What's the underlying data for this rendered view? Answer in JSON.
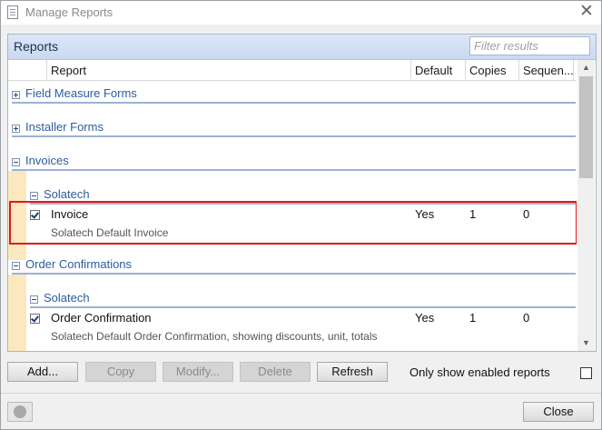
{
  "window": {
    "title": "Manage Reports",
    "close_glyph": "✕"
  },
  "panel": {
    "title": "Reports",
    "filter_placeholder": "Filter results"
  },
  "columns": {
    "report": "Report",
    "default": "Default",
    "copies": "Copies",
    "sequence": "Sequen..."
  },
  "groups": {
    "field_measure": "Field Measure Forms",
    "installer": "Installer Forms",
    "invoices": "Invoices",
    "invoices_vendor": "Solatech",
    "order_confirmations": "Order Confirmations",
    "order_vendor": "Solatech"
  },
  "items": {
    "invoice": {
      "name": "Invoice",
      "description": "Solatech Default Invoice",
      "default": "Yes",
      "copies": "1",
      "sequence": "0",
      "checked": true
    },
    "order_confirmation": {
      "name": "Order Confirmation",
      "description": "Solatech Default Order Confirmation, showing discounts, unit, totals",
      "default": "Yes",
      "copies": "1",
      "sequence": "0",
      "checked": true
    }
  },
  "scrollbar": {
    "up_glyph": "▲",
    "down_glyph": "▼"
  },
  "buttons": {
    "add": "Add...",
    "copy": "Copy",
    "modify": "Modify...",
    "delete": "Delete",
    "refresh": "Refresh",
    "close": "Close"
  },
  "options": {
    "only_enabled_label": "Only show enabled reports",
    "only_enabled_checked": false
  },
  "colors": {
    "highlight": "#e0191b",
    "group_text": "#2e5c9e",
    "indent_band": "#fbe8bf"
  }
}
